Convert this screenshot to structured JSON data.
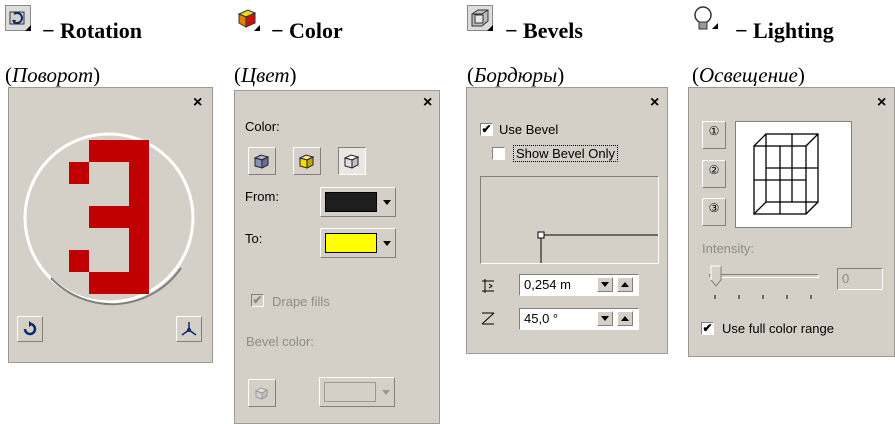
{
  "captions": [
    {
      "icon": "rotation-icon",
      "title": "− Rotation",
      "subtitle": "Поворот"
    },
    {
      "icon": "color-icon",
      "title": "− Color",
      "subtitle": "Цвет"
    },
    {
      "icon": "bevels-icon",
      "title": "− Bevels",
      "subtitle": "Бордюры"
    },
    {
      "icon": "lighting-icon",
      "title": "− Lighting",
      "subtitle": "Освещение"
    }
  ],
  "close_symbol": "×",
  "rotation": {
    "digit": "3",
    "digit_color": "#c00000"
  },
  "color": {
    "label": "Color:",
    "from_label": "From:",
    "from_color": "#1e1e1e",
    "to_label": "To:",
    "to_color": "#ffff00",
    "drape_label": "Drape fills",
    "drape_checked": true,
    "bevel_color_label": "Bevel color:"
  },
  "bevels": {
    "use_bevel_label": "Use Bevel",
    "use_bevel_checked": true,
    "show_bevel_only_label": "Show Bevel Only",
    "show_bevel_only_checked": false,
    "width_value": "0,254 m",
    "angle_value": "45,0 °"
  },
  "lighting": {
    "lights": [
      "①",
      "②",
      "③"
    ],
    "intensity_label": "Intensity:",
    "intensity_value": "0",
    "full_color_label": "Use full color range",
    "full_color_checked": true
  },
  "check_mark": "✔"
}
